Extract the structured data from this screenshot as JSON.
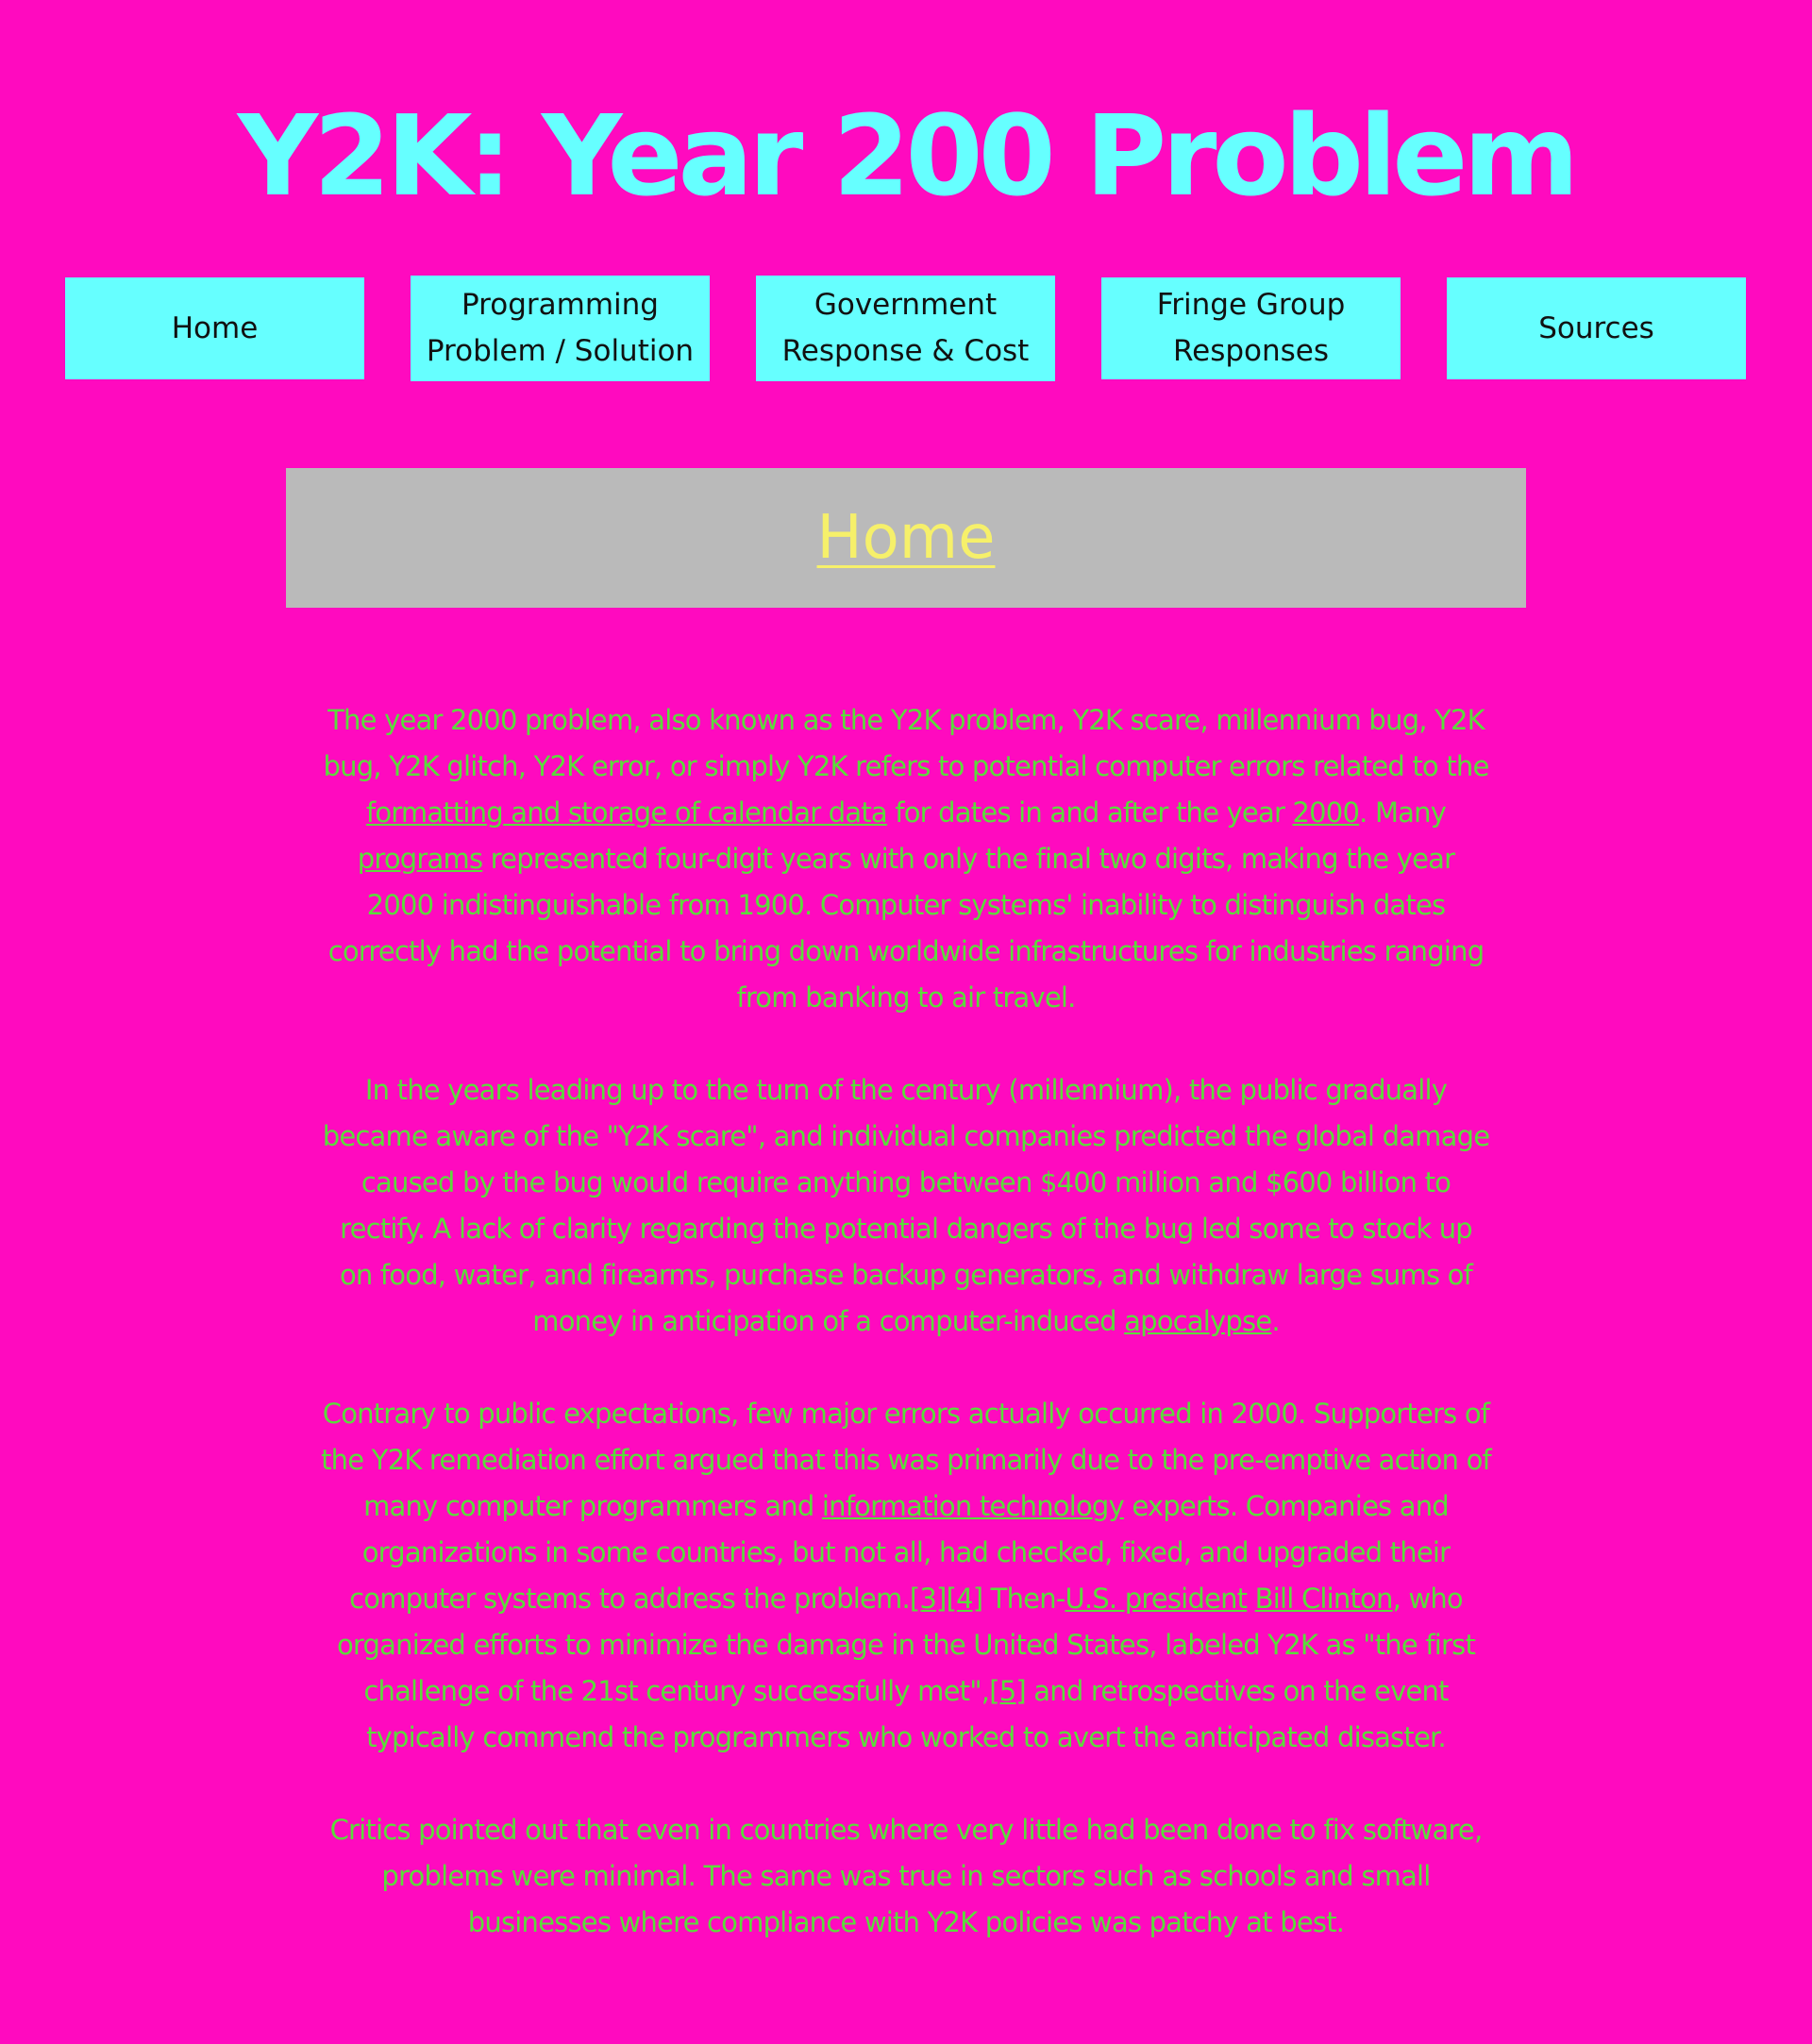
{
  "header": {
    "title": "Y2K: Year 200 Problem"
  },
  "nav": {
    "items": [
      {
        "label": "Home"
      },
      {
        "label": "Programming\nProblem / Solution"
      },
      {
        "label": "Government\nResponse & Cost"
      },
      {
        "label": "Fringe Group\nResponses"
      },
      {
        "label": "Sources"
      }
    ]
  },
  "section": {
    "title": "Home"
  },
  "content": {
    "p1": {
      "t1": "The year 2000 problem, also known as the Y2K problem, Y2K scare, millennium bug, Y2K bug, Y2K glitch, Y2K error, or simply Y2K refers to potential computer errors related to the ",
      "link1": "formatting and storage of calendar data",
      "t2": " for dates in and after the year ",
      "link2": "2000",
      "t3": ". Many ",
      "link3": "programs",
      "t4": " represented four-digit years with only the final two digits, making the year 2000 indistinguishable from 1900. Computer systems' inability to distinguish dates correctly had the potential to bring down worldwide infrastructures for industries ranging from banking to air travel."
    },
    "p2": {
      "t1": "In the years leading up to the turn of the century (millennium), the public gradually became aware of the \"Y2K scare\", and individual companies predicted the global damage caused by the bug would require anything between $400 million and $600 billion to rectify. A lack of clarity regarding the potential dangers of the bug led some to stock up on food, water, and firearms, purchase backup generators, and withdraw large sums of money in anticipation of a computer-induced ",
      "link1": "apocalypse",
      "t2": "."
    },
    "p3": {
      "t1": "Contrary to public expectations, few major errors actually occurred in 2000. Supporters of the Y2K remediation effort argued that this was primarily due to the pre-emptive action of many computer programmers and ",
      "link1": "information technology",
      "t2": " experts. Companies and organizations in some countries, but not all, had checked, fixed, and upgraded their computer systems to address the problem.",
      "ref1": "[3]",
      "ref2": "[4]",
      "t3": " Then-",
      "link2": "U.S. president",
      "t4": " ",
      "link3": "Bill Clinton",
      "t5": ", who organized efforts to minimize the damage in the United States, labeled Y2K as \"the first challenge of the 21st century successfully met\",",
      "ref3": "[5]",
      "t6": " and retrospectives on the event typically commend the programmers who worked to avert the anticipated disaster."
    },
    "p4": {
      "t1": "Critics pointed out that even in countries where very little had been done to fix software, problems were minimal. The same was true in sectors such as schools and small businesses where compliance with Y2K policies was patchy at best."
    }
  }
}
